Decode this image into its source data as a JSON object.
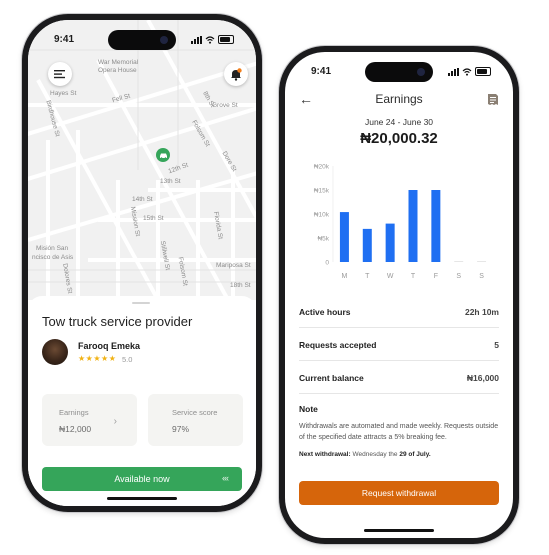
{
  "left": {
    "status_time": "9:41",
    "map_labels": [
      "War Memorial",
      "Opera House",
      "Hayes St",
      "Fell St",
      "8th St",
      "Birdhouse St",
      "Grove St",
      "Folsom St",
      "12th St",
      "Dore St",
      "13th St",
      "14th St",
      "Mission St",
      "15th St",
      "Florida St",
      "Stillwell St",
      "Folsom St",
      "Misión San",
      "ncisco de Asis",
      "Dolores St",
      "Mariposa St",
      "18th St"
    ],
    "sheet_title": "Tow truck service provider",
    "driver": {
      "name": "Farooq Emeka",
      "stars": "★★★★★",
      "rating": "5.0"
    },
    "earnings_card": {
      "label": "Earnings",
      "value": "₦12,000",
      "chevron": "›"
    },
    "score_card": {
      "label": "Service score",
      "value": "97%"
    },
    "available_button": {
      "label": "Available now",
      "chevron": "‹‹‹"
    },
    "icons": {
      "menu": "menu-icon",
      "bell": "notification-bell-icon",
      "car": "car-marker-icon"
    },
    "colors": {
      "green": "#35a55a",
      "alert": "#f07d1a"
    }
  },
  "right": {
    "status_time": "9:41",
    "title": "Earnings",
    "back": "←",
    "date_range": "June 24 - June 30",
    "total": "₦20,000.32",
    "chart_data": {
      "type": "bar",
      "categories": [
        "M",
        "T",
        "W",
        "T",
        "F",
        "S",
        "S"
      ],
      "values": [
        10400,
        6900,
        8000,
        15000,
        15000,
        0,
        0
      ],
      "ylim": [
        0,
        20000
      ],
      "yticks": [
        "₦20k",
        "₦15k",
        "₦10k",
        "₦5k",
        "0"
      ],
      "color": "#1f6ff2"
    },
    "stats": [
      {
        "label": "Active hours",
        "value": "22h 10m"
      },
      {
        "label": "Requests accepted",
        "value": "5"
      },
      {
        "label": "Current balance",
        "value": "₦16,000"
      }
    ],
    "note": {
      "title": "Note",
      "body": "Withdrawals are automated and made weekly. Requests outside of the specified date attracts a 5% breaking fee.",
      "next_label": "Next withdrawal:",
      "next_text": " Wednesday the ",
      "next_date": "29 of July."
    },
    "withdraw_button": "Request withdrawal",
    "colors": {
      "orange": "#d6650b",
      "bar": "#1f6ff2"
    }
  }
}
